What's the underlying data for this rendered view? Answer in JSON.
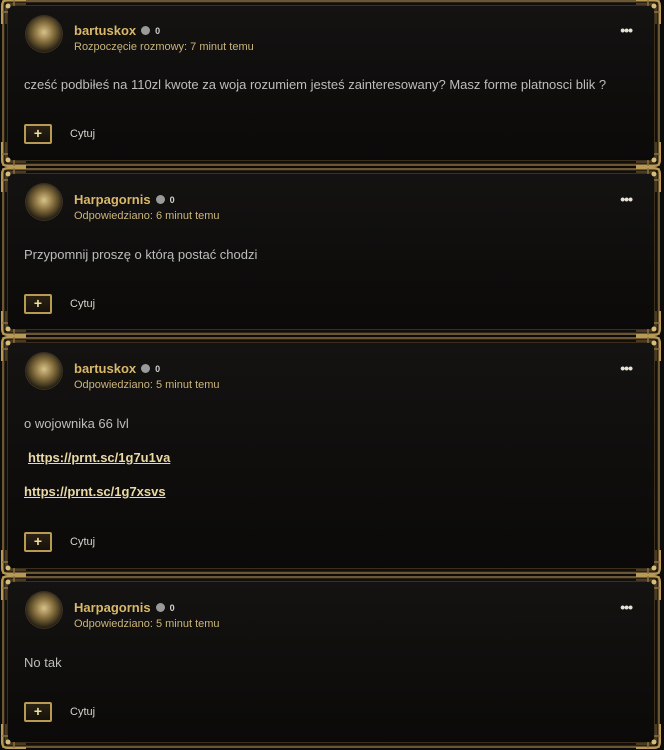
{
  "posts": [
    {
      "author": "bartuskox",
      "reputation": "0",
      "meta": "Rozpoczęcie rozmowy: 7 minut temu",
      "lines": [
        "cześć podbiłeś na 110zl kwote za woja rozumiem jesteś zainteresowany? Masz forme platnosci blik ?"
      ],
      "quote_label": "Cytuj",
      "more_label": "•••"
    },
    {
      "author": "Harpagornis",
      "reputation": "0",
      "meta": "Odpowiedziano: 6 minut temu",
      "lines": [
        "Przypomnij proszę o którą postać chodzi"
      ],
      "quote_label": "Cytuj",
      "more_label": "•••"
    },
    {
      "author": "bartuskox",
      "reputation": "0",
      "meta": "Odpowiedziano: 5 minut temu",
      "lines": [
        "o wojownika 66 lvl"
      ],
      "links": [
        "https://prnt.sc/1g7u1va",
        "https://prnt.sc/1g7xsvs"
      ],
      "quote_label": "Cytuj",
      "more_label": "•••"
    },
    {
      "author": "Harpagornis",
      "reputation": "0",
      "meta": "Odpowiedziano: 5 minut temu",
      "lines": [
        "No tak"
      ],
      "quote_label": "Cytuj",
      "more_label": "•••"
    }
  ],
  "icons": {
    "avatar": "golden-crest-avatar",
    "status": "offline-dot-icon",
    "more": "more-options-icon",
    "quote": "quote-plus-icon"
  },
  "colors": {
    "author": "#d9b86a",
    "meta": "#c9b47a",
    "frame": "#6b5633",
    "body_text": "#bdbdbd",
    "link": "#e8d9a6"
  }
}
